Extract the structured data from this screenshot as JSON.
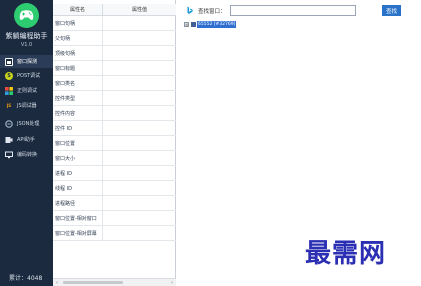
{
  "sidebar": {
    "app_name": "紫躺编程助手",
    "version": "V1.0",
    "items": [
      {
        "label": "窗口探测",
        "icon": "window-icon",
        "active": true
      },
      {
        "label": "POST调试",
        "icon": "post-s-icon",
        "active": false
      },
      {
        "label": "正则调试",
        "icon": "regex-grid-icon",
        "active": false
      },
      {
        "label": "JS调试器",
        "icon": "js-icon",
        "active": false
      },
      {
        "label": "JSON处理",
        "icon": "json-icon",
        "active": false
      },
      {
        "label": "API助手",
        "icon": "api-icon",
        "active": false
      },
      {
        "label": "编码转换",
        "icon": "monitor-icon",
        "active": false
      }
    ],
    "footer": "累计：4048",
    "accent": "#2ecc71"
  },
  "props": {
    "col_name": "属性名",
    "col_value": "属性值",
    "rows": [
      "窗口句柄",
      "父句柄",
      "顶级句柄",
      "窗口标题",
      "窗口类名",
      "控件类型",
      "控件内容",
      "控件 ID",
      "窗口位置",
      "窗口大小",
      "进程 ID",
      "线程 ID",
      "进程路径",
      "窗口位置-相对窗口",
      "窗口位置-相对屏幕"
    ]
  },
  "search": {
    "label": "查找窗口：",
    "value": "",
    "button": "查找"
  },
  "tree": {
    "expander": "⊞",
    "node_label": "65552 [#32769]"
  },
  "watermark": "最需网"
}
